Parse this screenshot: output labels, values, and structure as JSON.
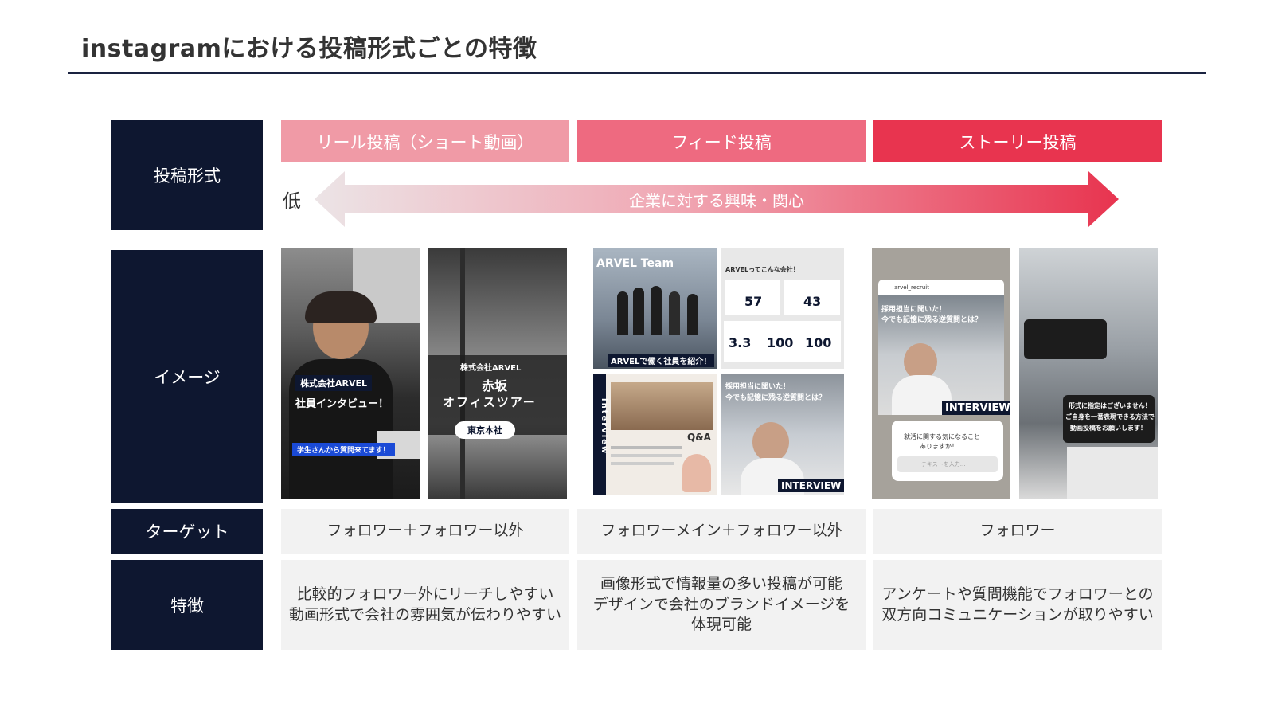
{
  "title": "instagramにおける投稿形式ごとの特徴",
  "row_labels": {
    "format": "投稿形式",
    "image": "イメージ",
    "target": "ターゲット",
    "feature": "特徴"
  },
  "arrow": {
    "low_label": "低",
    "text": "企業に対する興味・関心"
  },
  "columns": [
    {
      "type": "リール投稿（ショート動画）",
      "target": "フォロワー＋フォロワー以外",
      "feature": [
        "比較的フォロワー外にリーチしやすい",
        "動画形式で会社の雰囲気が伝わりやすい"
      ]
    },
    {
      "type": "フィード投稿",
      "target": "フォロワーメイン＋フォロワー以外",
      "feature": [
        "画像形式で情報量の多い投稿が可能",
        "デザインで会社のブランドイメージを",
        "体現可能"
      ]
    },
    {
      "type": "ストーリー投稿",
      "target": "フォロワー",
      "feature": [
        "アンケートや質問機能でフォロワーとの",
        "双方向コミュニケーションが取りやすい"
      ]
    }
  ],
  "images": {
    "reel1": {
      "line1": "株式会社ARVEL",
      "line2": "社員インタビュー！",
      "line3": "学生さんから質問来てます！"
    },
    "reel2": {
      "line1": "株式会社ARVEL",
      "line2": "赤坂",
      "line3": "オフィスツアー",
      "line4": "東京本社"
    },
    "feed1": {
      "line1": "ARVEL Team",
      "line2": "ARVELで働く社員を紹介！"
    },
    "feed2": {
      "line1": "ARVELってこんな会社！",
      "s1": "57",
      "s2": "43",
      "s3": "3.3",
      "s4": "100",
      "s5": "100"
    },
    "feed3": {
      "line1": "Interview",
      "line2": "Q&A"
    },
    "feed4": {
      "line1": "採用担当に聞いた！",
      "line2": "今でも記憶に残る逆質問とは？",
      "line3": "INTERVIEW"
    },
    "story1": {
      "line1": "arvel_recruit",
      "line2": "採用担当に聞いた！",
      "line3": "今でも記憶に残る逆質問とは？",
      "line4": "INTERVIEW",
      "line5": "就活に関する気になること",
      "line6": "ありますか！",
      "line7": "テキストを入力..."
    },
    "story2": {
      "line1": "形式に指定はございません！",
      "line2": "ご自身を一番表現できる方法で",
      "line3": "動画投稿をお願いします！"
    }
  },
  "colors": {
    "navy": "#0e1730",
    "reel": "#f09aa6",
    "feed": "#ee6a80",
    "story": "#e8344f",
    "cell_bg": "#f2f2f2"
  }
}
